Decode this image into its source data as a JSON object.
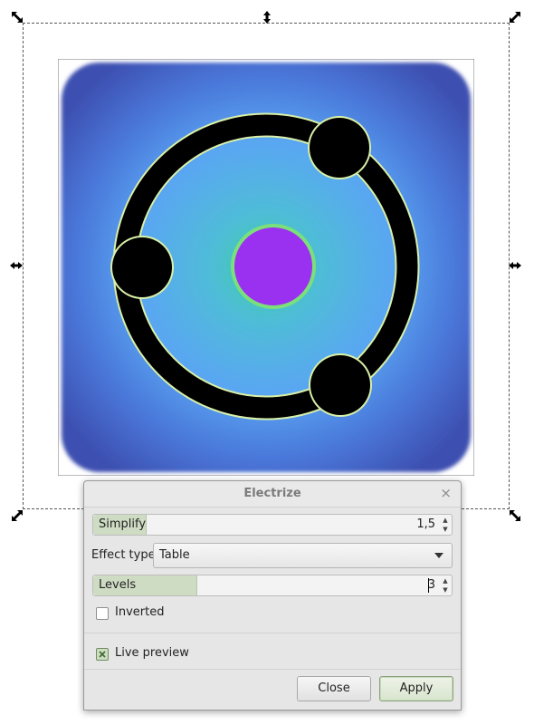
{
  "dialog": {
    "title": "Electrize",
    "close_glyph": "×",
    "simplify": {
      "label": "Simplify",
      "value": "1,5",
      "fill_fraction": 0.15
    },
    "effect_type": {
      "label": "Effect type:",
      "selected": "Table"
    },
    "levels": {
      "label": "Levels",
      "value": "3",
      "fill_fraction": 0.29
    },
    "inverted": {
      "label": "Inverted",
      "checked": false
    },
    "live_preview": {
      "label": "Live preview",
      "checked": true
    },
    "buttons": {
      "close": "Close",
      "apply": "Apply"
    }
  },
  "colors": {
    "background_outer": "#3d4fb0",
    "background_inner": "#5aa6f2",
    "center_glow": "#3fd0a0",
    "center_dot": "#9a30f0",
    "ring": "#000000",
    "accent_green": "#cfdcc4"
  },
  "icons": {
    "handles": "double-arrow-icon",
    "dialog_close": "close-icon",
    "spin": "spin-arrows-icon"
  }
}
